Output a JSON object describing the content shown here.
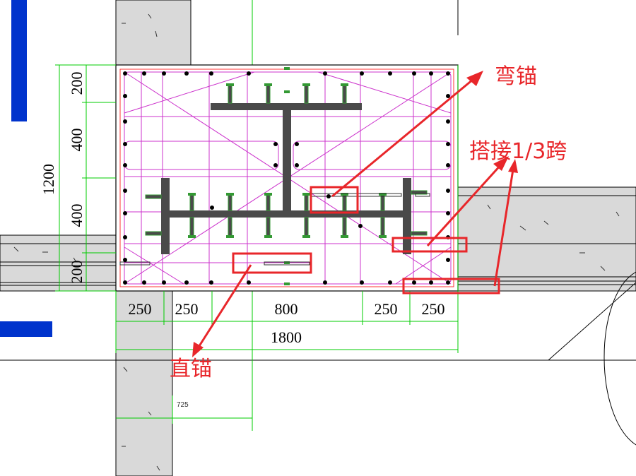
{
  "colors": {
    "concrete": "#d9d9d9",
    "steel": "#4a4a4a",
    "rebar_magenta": "#cc33cc",
    "dimension_green": "#00cc00",
    "annotation_red": "#e8262a",
    "cover_red": "#ff3333",
    "blue_bar": "#0033cc",
    "stud_green": "#339933"
  },
  "dimensions": {
    "height_total": "1200",
    "height_segments": [
      "200",
      "400",
      "400",
      "200"
    ],
    "width_total": "1800",
    "width_segments": [
      "250",
      "250",
      "800",
      "250",
      "250"
    ],
    "detail_length": "725"
  },
  "annotations": {
    "bent_anchor": "弯锚",
    "lap_splice": "搭接1/3跨",
    "straight_anchor": "直锚"
  }
}
